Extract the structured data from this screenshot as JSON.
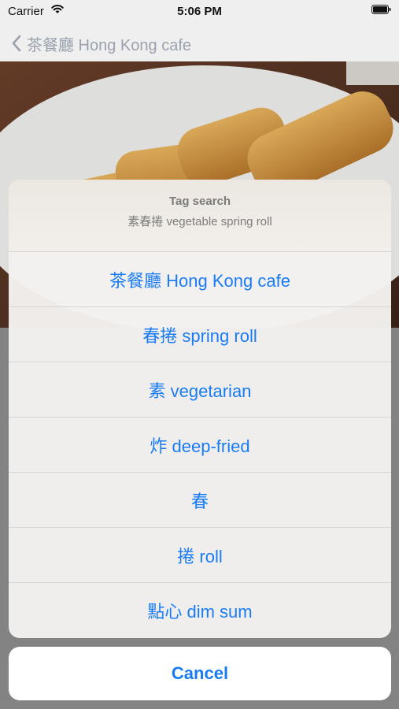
{
  "status_bar": {
    "carrier": "Carrier",
    "time": "5:06 PM"
  },
  "nav": {
    "back_title": "茶餐廳 Hong Kong cafe"
  },
  "action_sheet": {
    "title": "Tag search",
    "message": "素春捲 vegetable spring roll",
    "actions": [
      {
        "label": "茶餐廳 Hong Kong cafe"
      },
      {
        "label": "春捲 spring roll"
      },
      {
        "label": "素 vegetarian"
      },
      {
        "label": "炸 deep-fried"
      },
      {
        "label": "春"
      },
      {
        "label": "捲 roll"
      },
      {
        "label": "點心 dim sum"
      }
    ],
    "cancel_label": "Cancel"
  },
  "colors": {
    "accent": "#1a7cf4",
    "nav_tint": "#9aa2ad"
  },
  "icons": {
    "back": "chevron-left-icon",
    "wifi": "wifi-icon",
    "battery": "battery-icon"
  }
}
